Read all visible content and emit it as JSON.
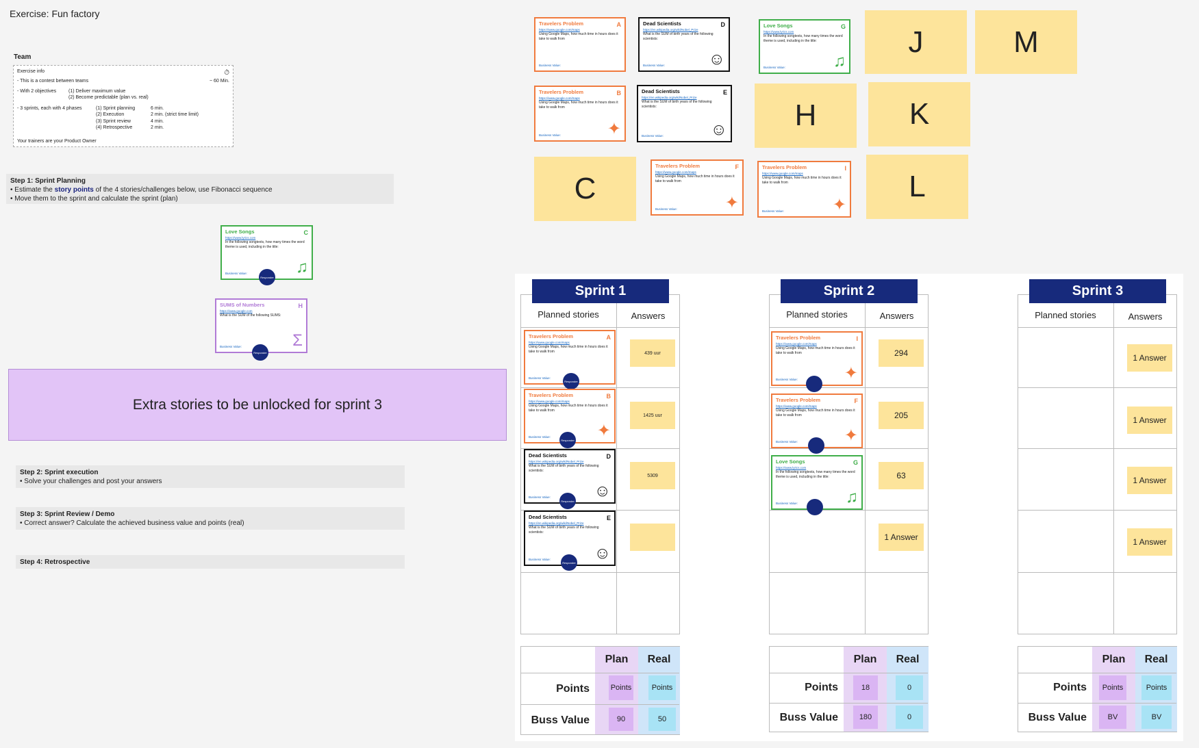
{
  "title": "Exercise: Fun factory",
  "team_label": "Team",
  "info": {
    "heading": "Exercise info",
    "duration": "~ 60 Min.",
    "contest": "- This is a contest between teams",
    "objectives_label": "- With 2 objectives",
    "objective_1": "(1) Deliver maximum value",
    "objective_2": "(2) Become predictable (plan vs. real)",
    "sprints_label": "- 3 sprints, each with 4 phases",
    "phases": [
      {
        "name": "(1) Sprint planning",
        "time": "6 min."
      },
      {
        "name": "(2) Execution",
        "time": "2 min. (strict time limit)"
      },
      {
        "name": "(3) Sprint review",
        "time": "4 min."
      },
      {
        "name": "(4) Retrospective",
        "time": "2 min."
      }
    ],
    "footer": "Your trainers are your Product Owner"
  },
  "steps": {
    "step1_title": "Step 1: Sprint Planning",
    "step1_line1_a": "• Estimate the ",
    "step1_line1_hl": "story points",
    "step1_line1_b": " of the 4 stories/challenges below, use Fibonacci sequence",
    "step1_line2": "• Move them to the sprint and calculate the sprint (plan)",
    "step2_title": "Step 2: Sprint execution",
    "step2_line": "• Solve your challenges and post your answers",
    "step3_title": "Step 3: Sprint Review / Demo",
    "step3_line": "• Correct answer? Calculate the achieved business value and points (real)",
    "step4_title": "Step 4: Retrospective"
  },
  "extra_banner": "Extra stories to be unlocked for sprint 3",
  "cards": {
    "travelers": {
      "title": "Travelers Problem",
      "link": "https://www.google.com/maps",
      "body": "Using Google Maps, how much time in hours does it take to walk from"
    },
    "dead": {
      "title": "Dead Scientists",
      "link": "https://en.wikipedia.org/wiki/Nobel_Prize",
      "body": "What is the SUM of birth years of the following scientists:"
    },
    "love": {
      "title": "Love Songs",
      "link": "https://www.lyrics.com",
      "body": "In the following songtexts, how many times the word theme is used, including in the title:"
    },
    "sums": {
      "title": "SUMS of Numbers",
      "link": "https://www.google.com",
      "body": "What is the SUM of the following SUMS:"
    },
    "bv": "Business Value:",
    "dot": "Responder"
  },
  "letters": {
    "A": "A",
    "B": "B",
    "C": "C",
    "D": "D",
    "E": "E",
    "F": "F",
    "G": "G",
    "H": "H",
    "I": "I",
    "J": "J",
    "K": "K",
    "L": "L",
    "M": "M"
  },
  "sprints": [
    {
      "title": "Sprint 1",
      "planned_label": "Planned stories",
      "answers_label": "Answers",
      "answers": [
        "439 uur",
        "1425 uur",
        "5309",
        ""
      ],
      "plan_label": "Plan",
      "real_label": "Real",
      "points_label": "Points",
      "bv_label": "Buss Value",
      "points_plan": "Points",
      "points_real": "Points",
      "bv_plan": "90",
      "bv_real": "50"
    },
    {
      "title": "Sprint 2",
      "planned_label": "Planned stories",
      "answers_label": "Answers",
      "answers": [
        "294",
        "205",
        "63",
        "1 Answer"
      ],
      "plan_label": "Plan",
      "real_label": "Real",
      "points_label": "Points",
      "bv_label": "Buss Value",
      "points_plan": "18",
      "points_real": "0",
      "bv_plan": "180",
      "bv_real": "0"
    },
    {
      "title": "Sprint 3",
      "planned_label": "Planned stories",
      "answers_label": "Answers",
      "answers": [
        "1 Answer",
        "1 Answer",
        "1 Answer",
        "1 Answer"
      ],
      "plan_label": "Plan",
      "real_label": "Real",
      "points_label": "Points",
      "bv_label": "Buss Value",
      "points_plan": "Points",
      "points_real": "Points",
      "bv_plan": "BV",
      "bv_real": "BV"
    }
  ]
}
